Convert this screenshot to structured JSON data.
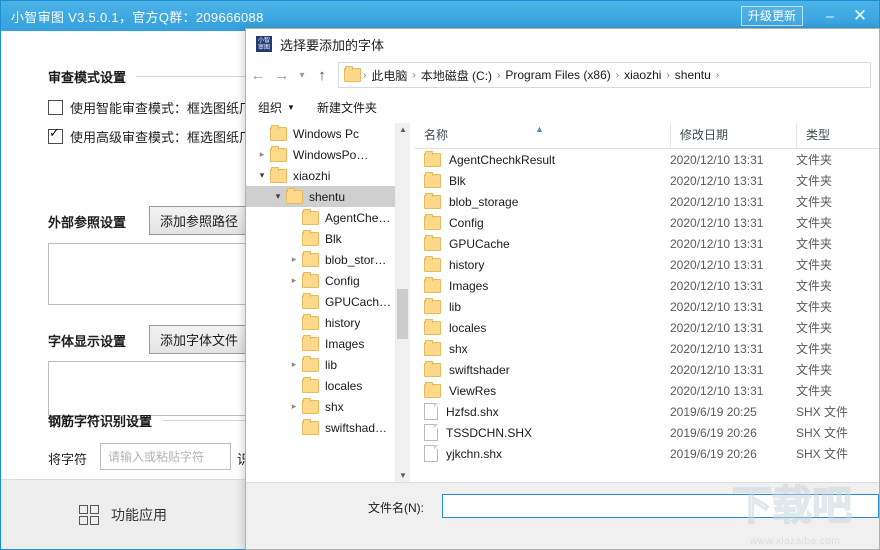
{
  "app": {
    "title": "小智审图 V3.5.0.1，官方Q群：209666088",
    "upgrade_label": "升级更新",
    "minimize_icon": "minimize-icon",
    "close_icon": "close-icon",
    "accent_color": "#3fa9e2",
    "sections": {
      "review_mode": {
        "heading": "审查模式设置",
        "checkboxes": [
          {
            "label": "使用智能审查模式：框选图纸厂",
            "checked": false
          },
          {
            "label": "使用高级审查模式：框选图纸厂",
            "checked": true
          }
        ]
      },
      "external_ref": {
        "heading": "外部参照设置",
        "button": "添加参照路径"
      },
      "font_display": {
        "heading": "字体显示设置",
        "button": "添加字体文件"
      },
      "rebar_char": {
        "heading": "钢筋字符识别设置",
        "prefix_label": "将字符",
        "input_placeholder": "请输入或粘贴字符",
        "suffix_label": "识"
      }
    },
    "footer": {
      "icon": "grid-apps-icon",
      "label": "功能应用"
    }
  },
  "dialog": {
    "icon": "app-logo-icon",
    "title": "选择要添加的字体",
    "nav": {
      "back_icon": "arrow-left-icon",
      "forward_icon": "arrow-right-icon",
      "history_icon": "chevron-down-icon",
      "up_icon": "arrow-up-icon",
      "breadcrumb_folder_icon": "folder-icon",
      "breadcrumb": [
        "此电脑",
        "本地磁盘 (C:)",
        "Program Files (x86)",
        "xiaozhi",
        "shentu"
      ],
      "separator": "›"
    },
    "toolbar": {
      "organize_label": "组织",
      "organize_caret": "chevron-down-icon",
      "new_folder_label": "新建文件夹"
    },
    "tree": {
      "scroll_up_icon": "scroll-up-icon",
      "scroll_down_icon": "scroll-down-icon",
      "items": [
        {
          "label": "Windows Pc",
          "indent": 1,
          "twisty": "",
          "selected": false
        },
        {
          "label": "WindowsPo…",
          "indent": 1,
          "twisty": "›",
          "selected": false
        },
        {
          "label": "xiaozhi",
          "indent": 1,
          "twisty": "⌄",
          "selected": false
        },
        {
          "label": "shentu",
          "indent": 2,
          "twisty": "⌄",
          "selected": true
        },
        {
          "label": "AgentChe…",
          "indent": 3,
          "twisty": "",
          "selected": false
        },
        {
          "label": "Blk",
          "indent": 3,
          "twisty": "",
          "selected": false
        },
        {
          "label": "blob_stor…",
          "indent": 3,
          "twisty": "›",
          "selected": false
        },
        {
          "label": "Config",
          "indent": 3,
          "twisty": "›",
          "selected": false
        },
        {
          "label": "GPUCach…",
          "indent": 3,
          "twisty": "",
          "selected": false
        },
        {
          "label": "history",
          "indent": 3,
          "twisty": "",
          "selected": false
        },
        {
          "label": "Images",
          "indent": 3,
          "twisty": "",
          "selected": false
        },
        {
          "label": "lib",
          "indent": 3,
          "twisty": "›",
          "selected": false
        },
        {
          "label": "locales",
          "indent": 3,
          "twisty": "",
          "selected": false
        },
        {
          "label": "shx",
          "indent": 3,
          "twisty": "›",
          "selected": false
        },
        {
          "label": "swiftshad…",
          "indent": 3,
          "twisty": "",
          "selected": false
        }
      ]
    },
    "list": {
      "columns": [
        {
          "label": "名称",
          "sorted": "asc",
          "sort_icon": "sort-ascending-icon"
        },
        {
          "label": "修改日期",
          "sorted": "",
          "sort_icon": ""
        },
        {
          "label": "类型",
          "sorted": "",
          "sort_icon": ""
        }
      ],
      "rows": [
        {
          "name": "AgentChechkResult",
          "date": "2020/12/10 13:31",
          "type": "文件夹",
          "kind": "folder"
        },
        {
          "name": "Blk",
          "date": "2020/12/10 13:31",
          "type": "文件夹",
          "kind": "folder"
        },
        {
          "name": "blob_storage",
          "date": "2020/12/10 13:31",
          "type": "文件夹",
          "kind": "folder"
        },
        {
          "name": "Config",
          "date": "2020/12/10 13:31",
          "type": "文件夹",
          "kind": "folder"
        },
        {
          "name": "GPUCache",
          "date": "2020/12/10 13:31",
          "type": "文件夹",
          "kind": "folder"
        },
        {
          "name": "history",
          "date": "2020/12/10 13:31",
          "type": "文件夹",
          "kind": "folder"
        },
        {
          "name": "Images",
          "date": "2020/12/10 13:31",
          "type": "文件夹",
          "kind": "folder"
        },
        {
          "name": "lib",
          "date": "2020/12/10 13:31",
          "type": "文件夹",
          "kind": "folder"
        },
        {
          "name": "locales",
          "date": "2020/12/10 13:31",
          "type": "文件夹",
          "kind": "folder"
        },
        {
          "name": "shx",
          "date": "2020/12/10 13:31",
          "type": "文件夹",
          "kind": "folder"
        },
        {
          "name": "swiftshader",
          "date": "2020/12/10 13:31",
          "type": "文件夹",
          "kind": "folder"
        },
        {
          "name": "ViewRes",
          "date": "2020/12/10 13:31",
          "type": "文件夹",
          "kind": "folder"
        },
        {
          "name": "Hzfsd.shx",
          "date": "2019/6/19 20:25",
          "type": "SHX 文件",
          "kind": "file"
        },
        {
          "name": "TSSDCHN.SHX",
          "date": "2019/6/19 20:26",
          "type": "SHX 文件",
          "kind": "file"
        },
        {
          "name": "yjkchn.shx",
          "date": "2019/6/19 20:26",
          "type": "SHX 文件",
          "kind": "file"
        }
      ]
    },
    "bottom": {
      "filename_label": "文件名(N):",
      "filename_value": "",
      "filename_placeholder": ""
    }
  },
  "watermark": {
    "text": "下载吧",
    "url": "www.xiazaiba.com"
  }
}
